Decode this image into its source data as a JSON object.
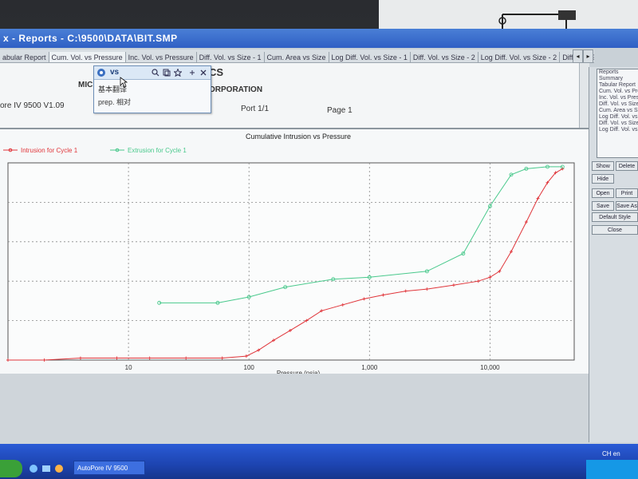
{
  "window": {
    "title": "x - Reports - C:\\9500\\DATA\\BIT.SMP"
  },
  "tabs": [
    "abular Report",
    "Cum. Vol. vs Pressure",
    "Inc. Vol. vs Pressure",
    "Diff. Vol. vs Size - 1",
    "Cum. Area vs Size",
    "Log Diff. Vol. vs Size - 1",
    "Diff. Vol. vs Size - 2",
    "Log Diff. Vol. vs Size - 2",
    "Diff. Ref. % Vol. vs Size"
  ],
  "tab_nav": {
    "left": "◂",
    "right": "▸"
  },
  "report": {
    "company_fragment": "CS",
    "company_prefix": "MIC",
    "corporation": "ORPORATION",
    "software": "ore IV 9500 V1.09",
    "port": "Port 1/1",
    "page": "Page 1"
  },
  "popup": {
    "word": "vs",
    "row1": "基本翻译",
    "row2": "prep. 相对"
  },
  "right_panel": {
    "list": [
      "Reports",
      "Summary",
      "Tabular Report",
      "Cum. Vol. vs Pres",
      "Inc. Vol. vs Pres",
      "Diff. Vol. vs Size",
      "Cum. Area vs Size",
      "Log Diff. Vol. vs",
      "Diff. Vol. vs Size",
      "Log Diff. Vol. vs"
    ],
    "show": "Show",
    "delete": "Delete",
    "hide": "Hide",
    "open": "Open",
    "print": "Print",
    "save": "Save",
    "save_as": "Save As",
    "default_style": "Default Style",
    "close": "Close"
  },
  "taskbar": {
    "task": "AutoPore IV 9500",
    "tray": "CH  en"
  },
  "chart_data": {
    "type": "line",
    "title": "Cumulative Intrusion vs Pressure",
    "xlabel": "Pressure (psia)",
    "xscale": "log",
    "xlim": [
      1,
      50000
    ],
    "ylim": [
      0,
      1
    ],
    "xticks": [
      10,
      100,
      1000,
      10000
    ],
    "xtick_labels": [
      "10",
      "100",
      "1,000",
      "10,000"
    ],
    "series": [
      {
        "name": "Intrusion for Cycle 1",
        "color": "#e0353a",
        "x": [
          1,
          2,
          4,
          8,
          15,
          30,
          60,
          95,
          120,
          160,
          220,
          300,
          400,
          600,
          900,
          1300,
          2000,
          3000,
          5000,
          8000,
          10000,
          12000,
          15000,
          20000,
          25000,
          30000,
          35000,
          40000
        ],
        "values": [
          0.0,
          0.0,
          0.01,
          0.01,
          0.01,
          0.01,
          0.01,
          0.02,
          0.05,
          0.1,
          0.15,
          0.2,
          0.25,
          0.28,
          0.31,
          0.33,
          0.35,
          0.36,
          0.38,
          0.4,
          0.42,
          0.45,
          0.55,
          0.7,
          0.82,
          0.9,
          0.95,
          0.97
        ]
      },
      {
        "name": "Extrusion for Cycle 1",
        "color": "#49c98c",
        "x": [
          18,
          55,
          100,
          200,
          500,
          1000,
          3000,
          6000,
          10000,
          15000,
          20000,
          30000,
          40000
        ],
        "values": [
          0.29,
          0.29,
          0.32,
          0.37,
          0.41,
          0.42,
          0.45,
          0.54,
          0.78,
          0.94,
          0.97,
          0.98,
          0.98
        ]
      }
    ]
  }
}
